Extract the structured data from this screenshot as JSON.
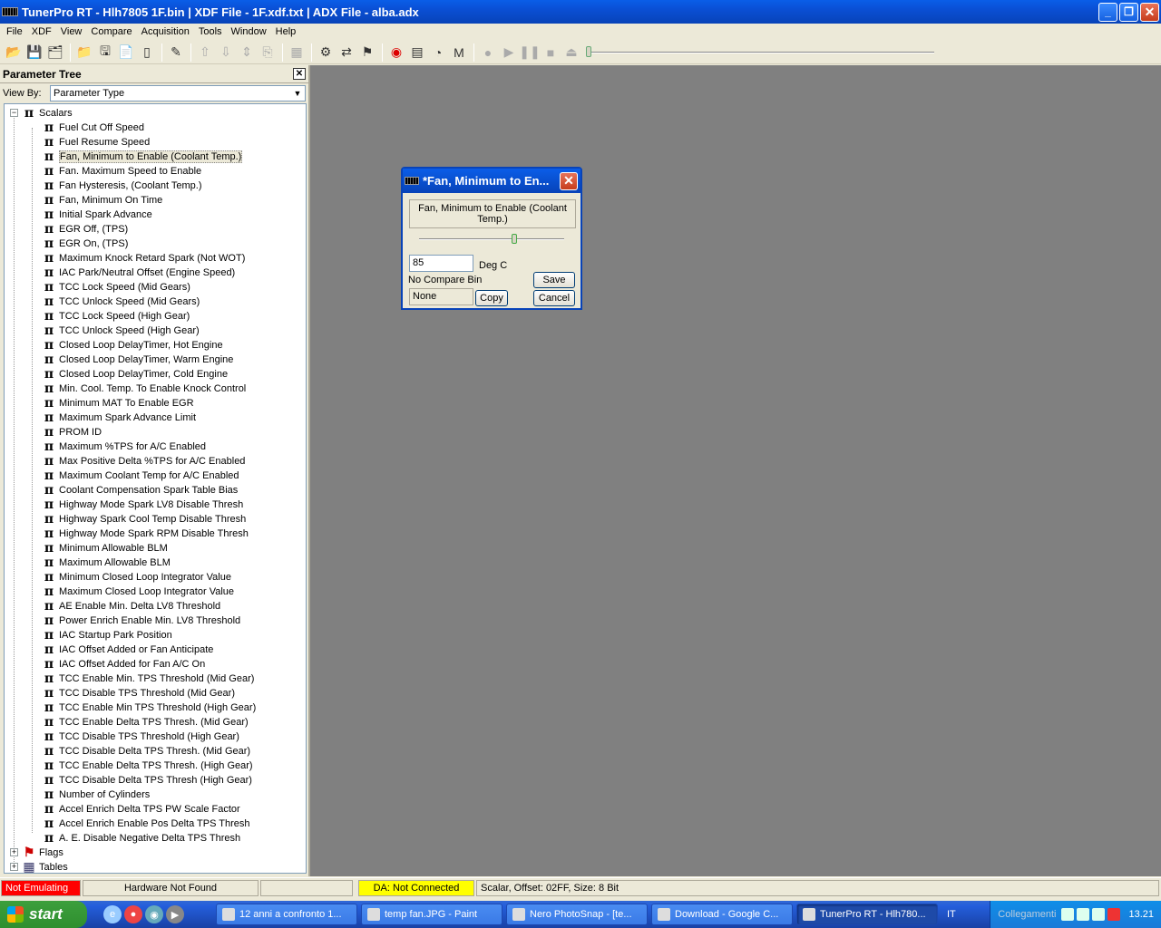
{
  "window": {
    "title": "TunerPro RT - Hlh7805 1F.bin | XDF File - 1F.xdf.txt | ADX File - alba.adx"
  },
  "menu": [
    "File",
    "XDF",
    "View",
    "Compare",
    "Acquisition",
    "Tools",
    "Window",
    "Help"
  ],
  "toolbar": {
    "icons": [
      "open-icon",
      "save-icon",
      "save-as-icon",
      "open-xdf-icon",
      "save-xdf-icon",
      "new-xdf-icon",
      "blank-doc-icon",
      "probe-icon",
      "arrow-up-icon",
      "arrow-down-icon",
      "move-icon",
      "copy-icon",
      "chip-icon",
      "settings-icon",
      "compare-icon",
      "flag-icon",
      "record-icon",
      "table-icon",
      "gauges-icon",
      "macro-icon",
      "stop-circle-icon",
      "play-icon",
      "pause-icon",
      "stop-icon",
      "eject-icon"
    ]
  },
  "tree": {
    "title": "Parameter Tree",
    "view_by_label": "View By:",
    "view_by_value": "Parameter Type",
    "root": "Scalars",
    "items": [
      "Fuel Cut Off Speed",
      "Fuel  Resume Speed",
      "Fan, Minimum to Enable (Coolant Temp.)",
      "Fan. Maximum Speed to Enable",
      "Fan Hysteresis, (Coolant Temp.)",
      "Fan, Minimum On Time",
      "Initial  Spark Advance",
      "EGR Off, (TPS)",
      "EGR On, (TPS)",
      "Maximum Knock Retard Spark  (Not WOT)",
      "IAC Park/Neutral Offset (Engine Speed)",
      "TCC Lock Speed (Mid Gears)",
      "TCC Unlock Speed (Mid Gears)",
      "TCC Lock Speed (High Gear)",
      "TCC Unlock Speed (High Gear)",
      "Closed Loop DelayTimer, Hot Engine",
      "Closed Loop DelayTimer, Warm Engine",
      "Closed Loop DelayTimer, Cold Engine",
      "Min. Cool. Temp. To Enable Knock Control",
      "Minimum MAT To Enable EGR",
      "Maximum Spark Advance Limit",
      "PROM ID",
      "Maximum %TPS for A/C Enabled",
      "Max Positive Delta %TPS for A/C Enabled",
      "Maximum Coolant Temp for A/C Enabled",
      "Coolant Compensation Spark Table Bias",
      "Highway Mode Spark LV8 Disable Thresh",
      "Highway Spark Cool Temp Disable Thresh",
      "Highway Mode Spark RPM Disable Thresh",
      "Minimum Allowable BLM",
      "Maximum Allowable BLM",
      "Minimum Closed Loop Integrator Value",
      "Maximum Closed Loop Integrator Value",
      "AE Enable Min. Delta LV8 Threshold",
      "Power Enrich Enable Min. LV8 Threshold",
      "IAC Startup Park Position",
      "IAC Offset Added or Fan Anticipate",
      "IAC Offset Added for Fan A/C On",
      "TCC Enable Min. TPS Threshold (Mid Gear)",
      "TCC Disable TPS Threshold (Mid Gear)",
      "TCC Enable Min TPS Threshold (High Gear)",
      "TCC Enable Delta TPS Thresh. (Mid Gear)",
      "TCC Disable TPS Threshold (High Gear)",
      "TCC Disable Delta TPS Thresh. (Mid Gear)",
      "TCC Enable Delta TPS Thresh. (High Gear)",
      "TCC Disable Delta TPS Thresh (High Gear)",
      "Number of Cylinders",
      "Accel Enrich Delta TPS PW Scale Factor",
      "Accel Enrich Enable Pos Delta TPS Thresh",
      "A. E. Disable Negative Delta TPS Thresh"
    ],
    "selected_index": 2,
    "flags_label": "Flags",
    "tables_label": "Tables"
  },
  "dialog": {
    "title": "*Fan, Minimum to En...",
    "description": "Fan, Minimum to Enable (Coolant Temp.)",
    "value": "85",
    "unit": "Deg C",
    "no_compare": "No Compare Bin",
    "compare_value": "None",
    "save": "Save",
    "copy": "Copy",
    "cancel": "Cancel"
  },
  "status": {
    "emulating": "Not Emulating",
    "hardware": "Hardware Not Found",
    "da": "DA: Not Connected",
    "info": "Scalar, Offset: 02FF,  Size: 8 Bit"
  },
  "taskbar": {
    "start": "start",
    "tasks": [
      "12 anni a confronto 1...",
      "temp fan.JPG - Paint",
      "Nero PhotoSnap - [te...",
      "Download - Google C...",
      "TunerPro RT - Hlh780..."
    ],
    "lang": "IT",
    "links": "Collegamenti",
    "clock": "13.21"
  }
}
